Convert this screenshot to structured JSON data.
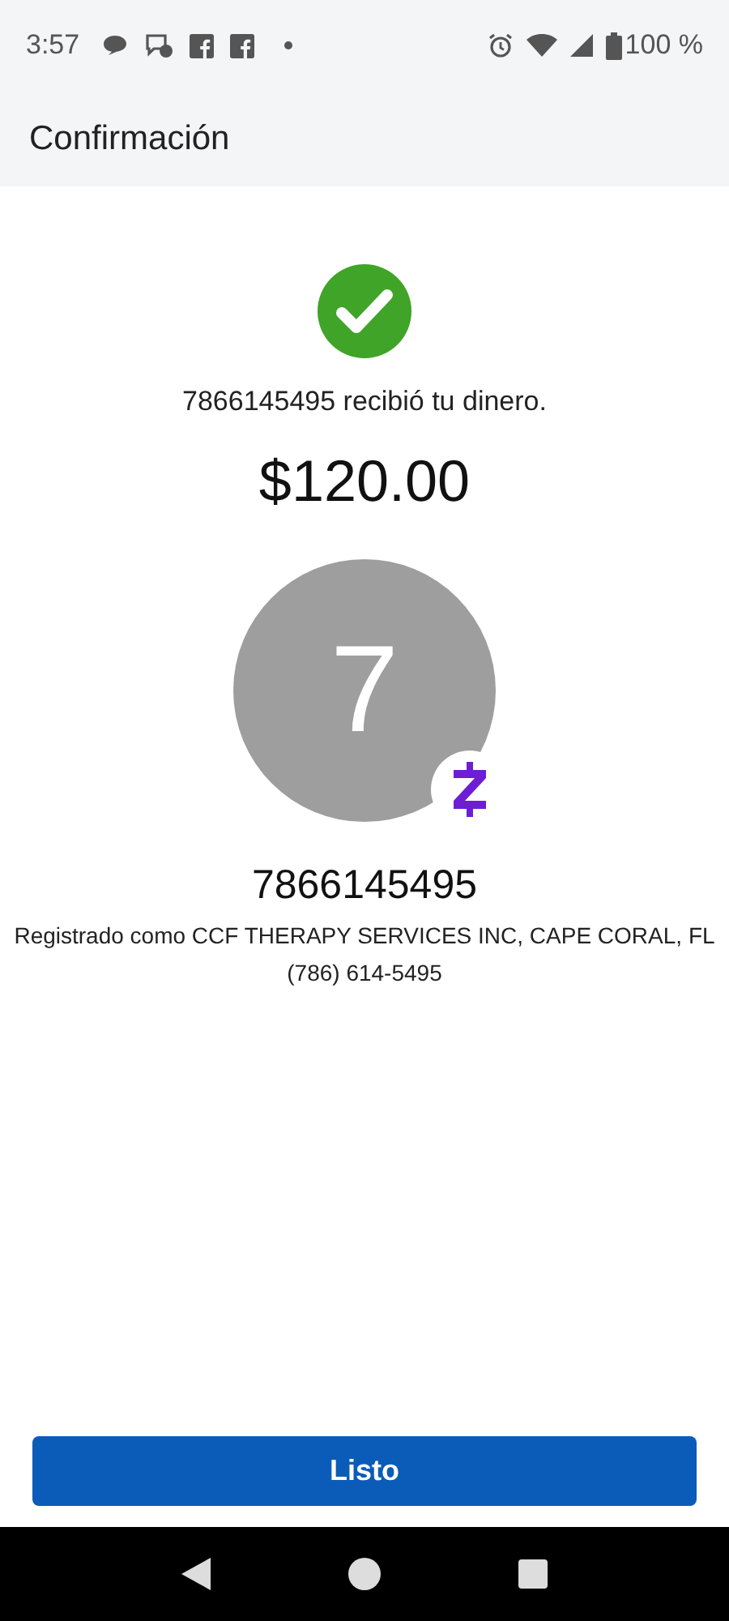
{
  "status_bar": {
    "time": "3:57",
    "battery": "100 %"
  },
  "header": {
    "title": "Confirmación"
  },
  "confirmation": {
    "message": "7866145495 recibió tu dinero.",
    "amount": "$120.00",
    "avatar_initial": "7",
    "recipient": "7866145495",
    "registered_as": "Registrado como CCF THERAPY SERVICES INC, CAPE CORAL, FL",
    "phone": "(786) 614-5495"
  },
  "done_button": {
    "label": "Listo"
  }
}
